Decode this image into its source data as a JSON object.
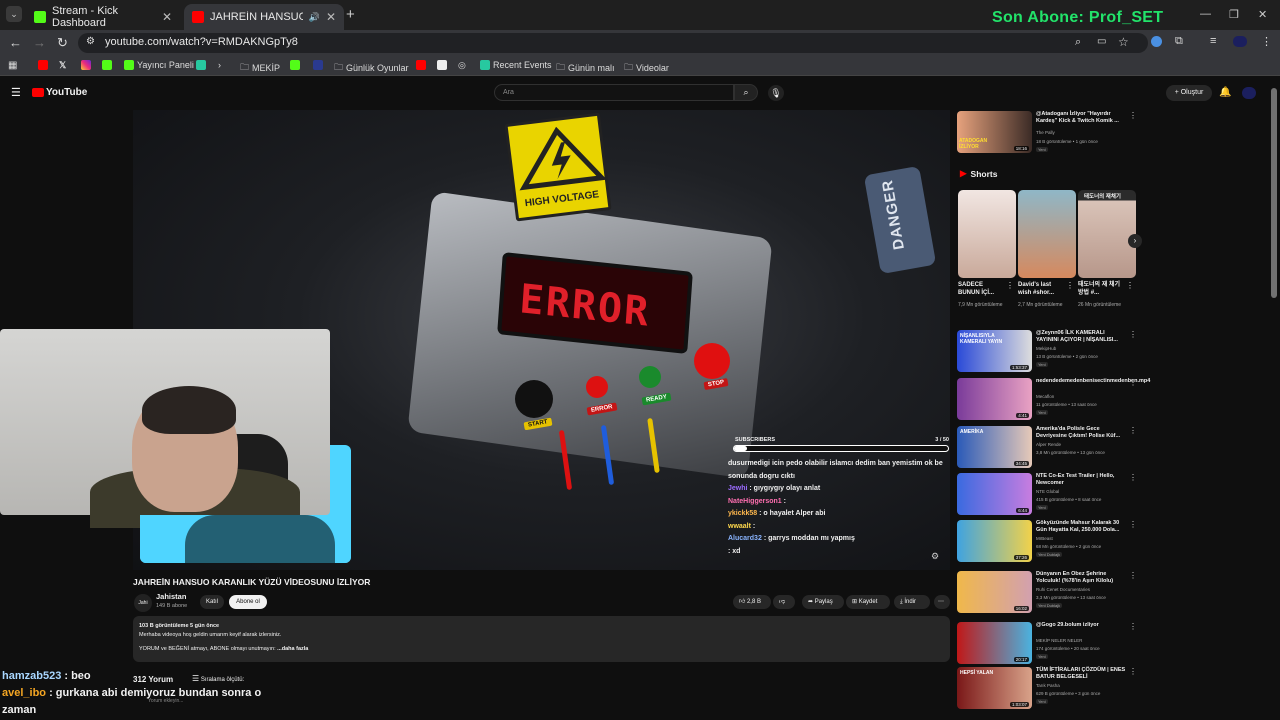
{
  "browser": {
    "tabs": [
      {
        "label": "Stream - Kick Dashboard",
        "color": "#53fc18"
      },
      {
        "label": "JAHREİN HANSUO KARANL",
        "color": "#ff0000"
      }
    ],
    "url": "youtube.com/watch?v=RMDAKNGpTy8",
    "overlay_banner": "Son Abone: Prof_SET",
    "bookmarks": [
      "Yayıncı Paneli",
      "MEKİP",
      "Günlük Oyunlar",
      "Recent Events",
      "Günün malı",
      "Videolar"
    ]
  },
  "youtube": {
    "logo": "YouTube",
    "search_placeholder": "Ara",
    "create_label": "Oluştur"
  },
  "video": {
    "scene_sign": "HIGH VOLTAGE",
    "scene_danger": "DANGER",
    "scene_error": "ERROR",
    "scene_buttons": [
      "START",
      "ERROR",
      "READY",
      "STOP"
    ],
    "subs_label": "SUBSCRIBERS",
    "subs_progress": "3 / 50",
    "subs_fraction": 0.06,
    "title": "JAHREİN HANSUO KARANLIK YÜZÜ VİDEOSUNU İZLİYOR",
    "channel": "Jahistan",
    "subscribers": "149 B abone",
    "join": "Katıl",
    "subscribe": "Abone ol",
    "likes": "2,8 B",
    "share": "Paylaş",
    "save": "Kaydet",
    "download": "İndir",
    "desc_meta": "103 B görüntüleme  5 gün önce",
    "desc_line1": "Merhaba videoya hoş geldin umarım keyif alarak izlersiniz.",
    "desc_line2": "YORUM ve BEĞENİ atmayı, ABONE olmayı unutmayın:",
    "desc_more": "...daha fazla",
    "comment_count": "312 Yorum",
    "sort_label": "Sıralama ölçütü:",
    "comment_placeholder": "Yorum ekleyin..."
  },
  "video_chat": [
    {
      "user": "",
      "text": "dusurmedigi icin pedo olabilir islamcı dedim ban yemistim ok be sonunda dogru cıktı",
      "color": "#ffffff"
    },
    {
      "user": "Jewhi",
      "text": ": gıygıygıy olayı anlat",
      "color": "#9b6bff"
    },
    {
      "user": "NateHiggerson1",
      "text": ":",
      "color": "#ff6fb0"
    },
    {
      "user": "ykickk58",
      "text": ": o hayalet Alper abi",
      "color": "#ffb84d"
    },
    {
      "user": "wwaalt",
      "text": ":",
      "color": "#ffd84d"
    },
    {
      "user": "Alucard32",
      "text": ": garrys moddan mı yapmış",
      "color": "#8ab4ff"
    },
    {
      "user": "",
      "text": ": xd",
      "color": "#c64dff"
    }
  ],
  "overlay_chat": [
    {
      "user": "hamzab523",
      "text": " : beo"
    },
    {
      "user": "avel_ibo",
      "text": " : gurkana abi demiyoruz bundan sonra o zaman"
    }
  ],
  "sidebar": {
    "top": {
      "title": "@Atadoganı İzliyor \"Hayırdır Kardeş\" Kick & Twitch Komik ...",
      "channel": "The Pally",
      "meta": "18 B görüntüleme • 1 gün önce",
      "badge": "Yeni",
      "duration": "18:16",
      "thumb_text": "ATADOGAN İZLİYOR"
    },
    "shorts_title": "Shorts",
    "shorts": [
      {
        "title": "SADECE BUNUN İÇİ...",
        "views": "7,9 Mn görüntüleme"
      },
      {
        "title": "David's last wish #shor...",
        "views": "2,7 Mn görüntüleme"
      },
      {
        "title": "태도너의 재 채기 방법 #...",
        "views": "26 Mn görüntüleme",
        "overlay": "태도너의 재채기"
      }
    ],
    "videos": [
      {
        "title": "@Zeynn06 İLK KAMERALI YAYININI AÇIYOR | NİŞANLISI...",
        "channel": "MekipHub",
        "meta": "13 B görüntüleme • 2 gün önce",
        "badge": "Yeni",
        "duration": "1:53:37",
        "thumb_text": "NİŞANLISIYLA KAMERALI YAYIN"
      },
      {
        "title": "nedendedemedenbenisectinmedenben.mp4",
        "channel": "Mecaflon",
        "meta": "11 görüntüleme • 13 saat önce",
        "badge": "Yeni",
        "duration": "4:41",
        "thumb_text": ""
      },
      {
        "title": "Amerika'da Polisle Gece Devriyesine Çıktım! Polise Küf...",
        "channel": "Alper Rende",
        "meta": "3,8 Mn görüntüleme • 13 gün önce",
        "badge": "",
        "duration": "34:45",
        "thumb_text": "AMERİKA"
      },
      {
        "title": "NTE Co-Ex Test Trailer | Hello, Newcomer",
        "channel": "NTE Global",
        "meta": "415 B görüntüleme • 8 saat önce",
        "badge": "Yeni",
        "duration": "6:44",
        "thumb_text": ""
      },
      {
        "title": "Gökyüzünde Mahsur Kalarak 30 Gün Hayatta Kal, 250.000 Dola...",
        "channel": "MrBeast",
        "meta": "68 Mn görüntüleme • 2 gün önce",
        "badge": "Yeni  Dublajlı",
        "duration": "37:26",
        "thumb_text": ""
      },
      {
        "title": "Dünyanın En Obez Şehrine Yolculuk! (%78'in Aşırı Kilolu)",
        "channel": "Ruhi Cenet Documentaries",
        "meta": "3,3 Mn görüntüleme • 13 saat önce",
        "badge": "Yeni  Dublajlı",
        "duration": "16:02",
        "thumb_text": ""
      },
      {
        "title": "@Gogo 29.bolum izliyor",
        "channel": "MEKİP NELER NELER",
        "meta": "174 görüntüleme • 20 saat önce",
        "badge": "Yeni",
        "duration": "20:17",
        "thumb_text": ""
      },
      {
        "title": "TÜM İFTİRALARI ÇÖZDÜM | ENES BATUR BELGESELİ",
        "channel": "Tarık Pasha",
        "meta": "629 B görüntüleme • 3 gün önce",
        "badge": "Yeni",
        "duration": "1:03:07",
        "thumb_text": "HEPSİ YALAN"
      }
    ]
  }
}
